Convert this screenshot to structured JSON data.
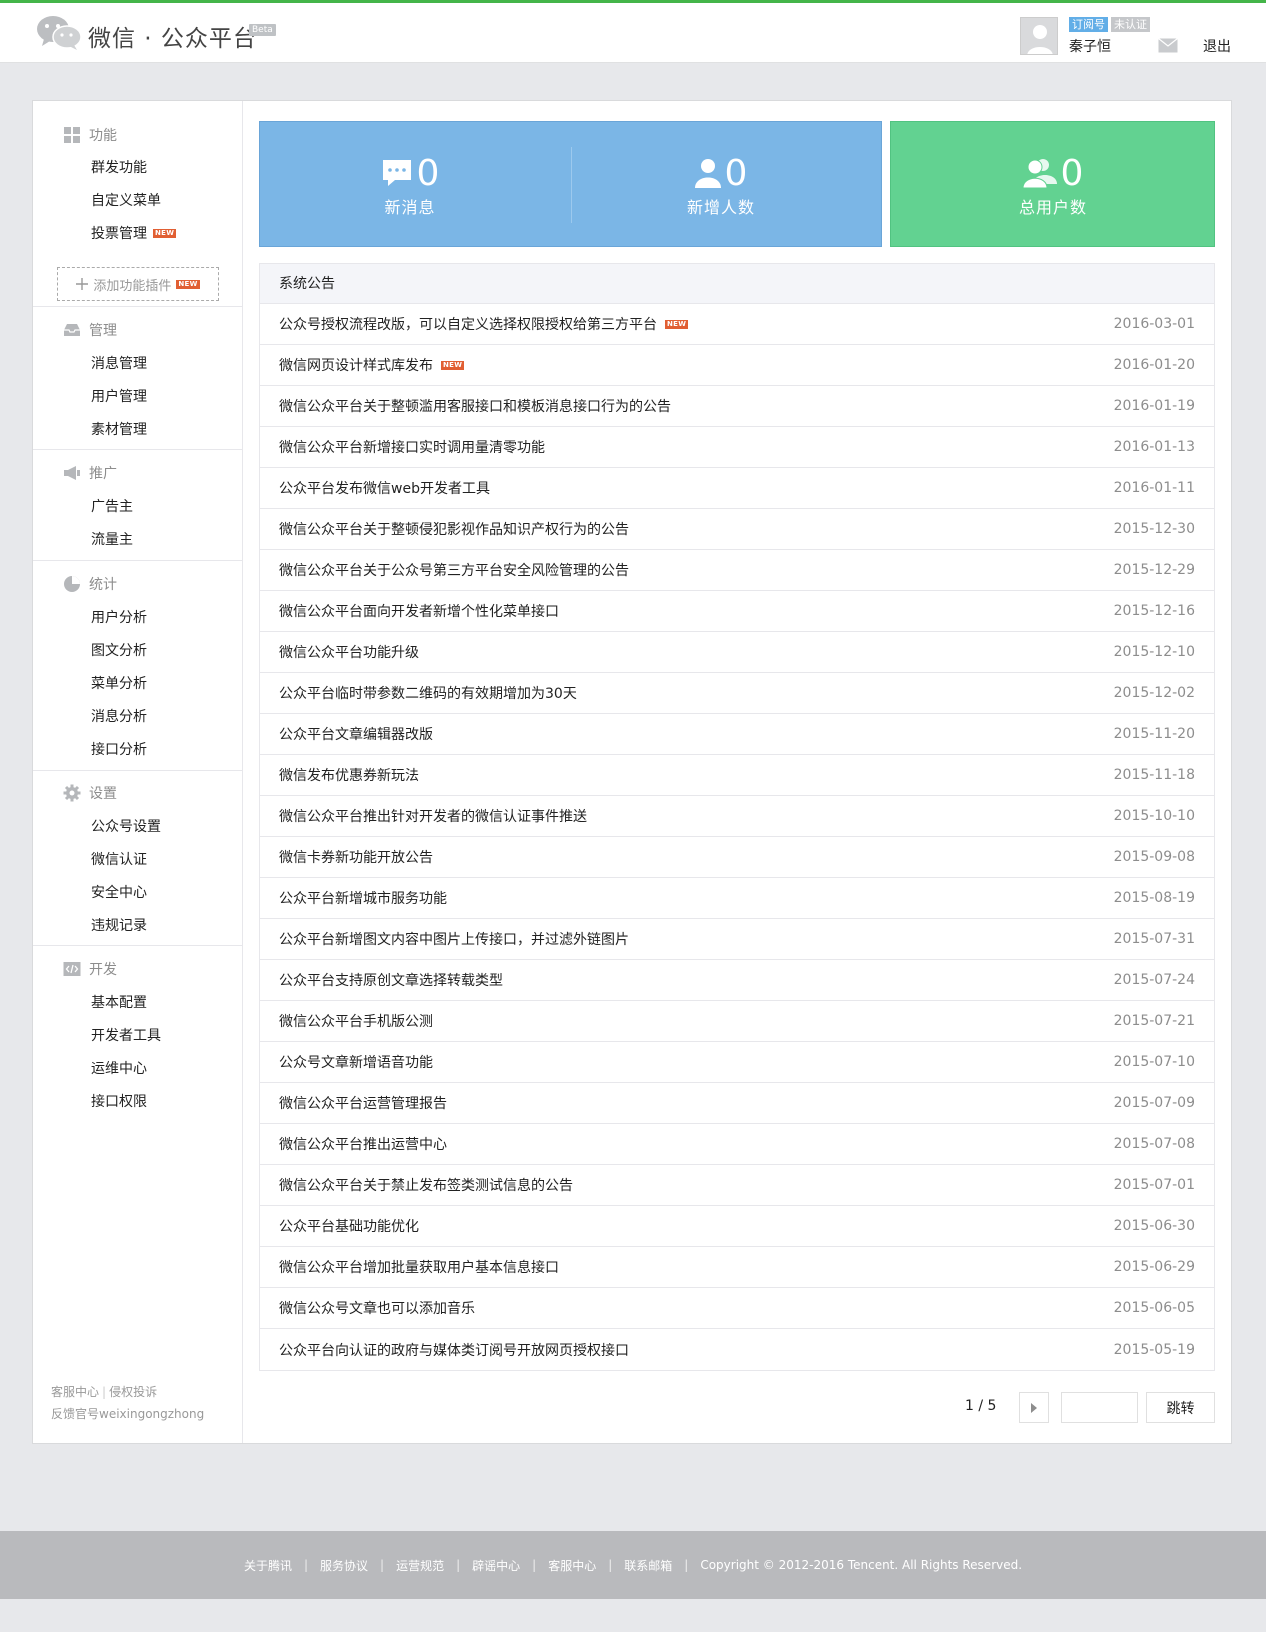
{
  "header": {
    "brand": "微信 · 公众平台",
    "beta": "Beta",
    "badge_subscription": "订阅号",
    "badge_unverified": "未认证",
    "username": "秦子恒",
    "logout": "退出"
  },
  "sidebar": {
    "groups": [
      {
        "title": "功能",
        "icon": "grid-icon",
        "items": [
          "群发功能",
          "自定义菜单",
          "投票管理"
        ]
      },
      {
        "title": "管理",
        "icon": "inbox-icon",
        "items": [
          "消息管理",
          "用户管理",
          "素材管理"
        ]
      },
      {
        "title": "推广",
        "icon": "megaphone-icon",
        "items": [
          "广告主",
          "流量主"
        ]
      },
      {
        "title": "统计",
        "icon": "pie-icon",
        "items": [
          "用户分析",
          "图文分析",
          "菜单分析",
          "消息分析",
          "接口分析"
        ]
      },
      {
        "title": "设置",
        "icon": "gear-icon",
        "items": [
          "公众号设置",
          "微信认证",
          "安全中心",
          "违规记录"
        ]
      },
      {
        "title": "开发",
        "icon": "code-icon",
        "items": [
          "基本配置",
          "开发者工具",
          "运维中心",
          "接口权限"
        ]
      }
    ],
    "new_tag": "NEW",
    "add_plugin": "添加功能插件",
    "footer_links": [
      "客服中心",
      "侵权投诉"
    ],
    "footer_feedback": "反馈官号weixingongzhong"
  },
  "stats": {
    "new_messages": {
      "value": "0",
      "label": "新消息"
    },
    "new_users": {
      "value": "0",
      "label": "新增人数"
    },
    "total_users": {
      "value": "0",
      "label": "总用户数"
    }
  },
  "notices": {
    "title": "系统公告",
    "items": [
      {
        "title": "公众号授权流程改版，可以自定义选择权限授权给第三方平台",
        "date": "2016-03-01",
        "new": true
      },
      {
        "title": "微信网页设计样式库发布",
        "date": "2016-01-20",
        "new": true
      },
      {
        "title": "微信公众平台关于整顿滥用客服接口和模板消息接口行为的公告",
        "date": "2016-01-19"
      },
      {
        "title": "微信公众平台新增接口实时调用量清零功能",
        "date": "2016-01-13"
      },
      {
        "title": "公众平台发布微信web开发者工具",
        "date": "2016-01-11"
      },
      {
        "title": "微信公众平台关于整顿侵犯影视作品知识产权行为的公告",
        "date": "2015-12-30"
      },
      {
        "title": "微信公众平台关于公众号第三方平台安全风险管理的公告",
        "date": "2015-12-29"
      },
      {
        "title": "微信公众平台面向开发者新增个性化菜单接口",
        "date": "2015-12-16"
      },
      {
        "title": "微信公众平台功能升级",
        "date": "2015-12-10"
      },
      {
        "title": "公众平台临时带参数二维码的有效期增加为30天",
        "date": "2015-12-02"
      },
      {
        "title": "公众平台文章编辑器改版",
        "date": "2015-11-20"
      },
      {
        "title": "微信发布优惠券新玩法",
        "date": "2015-11-18"
      },
      {
        "title": "微信公众平台推出针对开发者的微信认证事件推送",
        "date": "2015-10-10"
      },
      {
        "title": "微信卡券新功能开放公告",
        "date": "2015-09-08"
      },
      {
        "title": "公众平台新增城市服务功能",
        "date": "2015-08-19"
      },
      {
        "title": "公众平台新增图文内容中图片上传接口，并过滤外链图片",
        "date": "2015-07-31"
      },
      {
        "title": "公众平台支持原创文章选择转载类型",
        "date": "2015-07-24"
      },
      {
        "title": "微信公众平台手机版公测",
        "date": "2015-07-21"
      },
      {
        "title": "公众号文章新增语音功能",
        "date": "2015-07-10"
      },
      {
        "title": "微信公众平台运营管理报告",
        "date": "2015-07-09"
      },
      {
        "title": "微信公众平台推出运营中心",
        "date": "2015-07-08"
      },
      {
        "title": "微信公众平台关于禁止发布签类测试信息的公告",
        "date": "2015-07-01"
      },
      {
        "title": "公众平台基础功能优化",
        "date": "2015-06-30"
      },
      {
        "title": "微信公众平台增加批量获取用户基本信息接口",
        "date": "2015-06-29"
      },
      {
        "title": "微信公众号文章也可以添加音乐",
        "date": "2015-06-05"
      },
      {
        "title": "公众平台向认证的政府与媒体类订阅号开放网页授权接口",
        "date": "2015-05-19"
      }
    ]
  },
  "pager": {
    "page": "1 / 5",
    "jump_value": "",
    "jump_label": "跳转"
  },
  "footer": {
    "links": [
      "关于腾讯",
      "服务协议",
      "运营规范",
      "辟谣中心",
      "客服中心",
      "联系邮箱"
    ],
    "copyright": "Copyright © 2012-2016 Tencent. All Rights Reserved."
  },
  "colors": {
    "accent_green": "#44b549",
    "stat_blue": "#7bb6e6",
    "stat_green": "#62d291",
    "new_tag": "#e15f33"
  }
}
